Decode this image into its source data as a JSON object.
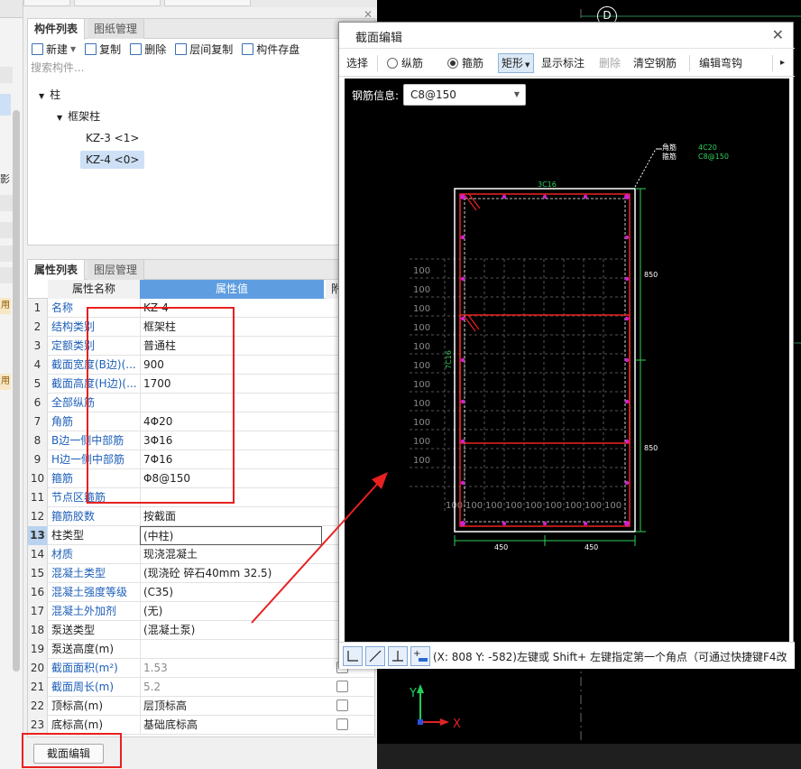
{
  "component_panel": {
    "tab_active": "构件列表",
    "tab_inactive": "图纸管理",
    "toolbar": {
      "new": "新建",
      "copy": "复制",
      "delete": "删除",
      "floor_copy": "层间复制",
      "save": "构件存盘"
    },
    "search_placeholder": "搜索构件...",
    "tree": {
      "root": "柱",
      "group": "框架柱",
      "items": [
        "KZ-3 <1>",
        "KZ-4 <0>"
      ]
    }
  },
  "property_panel": {
    "tab_active": "属性列表",
    "tab_inactive": "图层管理",
    "header_name": "属性名称",
    "header_value": "属性值",
    "header_extra": "附",
    "rows": [
      {
        "num": "1",
        "name": "名称",
        "value": "KZ-4"
      },
      {
        "num": "2",
        "name": "结构类别",
        "value": "框架柱"
      },
      {
        "num": "3",
        "name": "定额类别",
        "value": "普通柱"
      },
      {
        "num": "4",
        "name": "截面宽度(B边)(...",
        "value": "900"
      },
      {
        "num": "5",
        "name": "截面高度(H边)(...",
        "value": "1700"
      },
      {
        "num": "6",
        "name": "全部纵筋",
        "value": ""
      },
      {
        "num": "7",
        "name": "角筋",
        "value": "4Φ20"
      },
      {
        "num": "8",
        "name": "B边一侧中部筋",
        "value": "3Φ16"
      },
      {
        "num": "9",
        "name": "H边一侧中部筋",
        "value": "7Φ16"
      },
      {
        "num": "10",
        "name": "箍筋",
        "value": "Φ8@150"
      },
      {
        "num": "11",
        "name": "节点区箍筋",
        "value": ""
      },
      {
        "num": "12",
        "name": "箍筋胶数",
        "value": "按截面"
      },
      {
        "num": "13",
        "name": "柱类型",
        "value": "(中柱)"
      },
      {
        "num": "14",
        "name": "材质",
        "value": "现浇混凝土"
      },
      {
        "num": "15",
        "name": "混凝土类型",
        "value": "(现浇砼 碎石40mm 32.5)"
      },
      {
        "num": "16",
        "name": "混凝土强度等级",
        "value": "(C35)"
      },
      {
        "num": "17",
        "name": "混凝土外加剂",
        "value": "(无)"
      },
      {
        "num": "18",
        "name": "泵送类型",
        "value": "(混凝土泵)"
      },
      {
        "num": "19",
        "name": "泵送高度(m)",
        "value": ""
      },
      {
        "num": "20",
        "name": "截面面积(m²)",
        "value": "1.53"
      },
      {
        "num": "21",
        "name": "截面周长(m)",
        "value": "5.2"
      },
      {
        "num": "22",
        "name": "顶标高(m)",
        "value": "层顶标高"
      },
      {
        "num": "23",
        "name": "底标高(m)",
        "value": "基础底标高"
      }
    ]
  },
  "bottom_button": "截面编辑",
  "left_strip": {
    "ying": "影",
    "yong": "用"
  },
  "cad": {
    "grid_label": "D"
  },
  "dialog": {
    "title": "截面编辑",
    "toolbar": {
      "select": "选择",
      "longitudinal": "纵筋",
      "stirrup": "箍筋",
      "shape": "矩形",
      "show_label": "显示标注",
      "delete": "删除",
      "clear": "清空钢筋",
      "edit_hook": "编辑弯钩"
    },
    "rebar_info_label": "钢筋信息:",
    "rebar_info_value": "C8@150",
    "drawing": {
      "corner_label": "角筋",
      "stirrup_label": "箍筋",
      "corner_value": "4C20",
      "stirrup_value": "C8@150",
      "top_bar": "3C16",
      "side_bar": "7C16",
      "dim_850_top": "850",
      "dim_850_bottom": "850",
      "dim_450_left": "450",
      "dim_450_right": "450",
      "spacing": "100"
    },
    "status_text": "(X: 808 Y: -582)左键或 Shift+ 左键指定第一个角点（可通过快捷键F4改"
  }
}
